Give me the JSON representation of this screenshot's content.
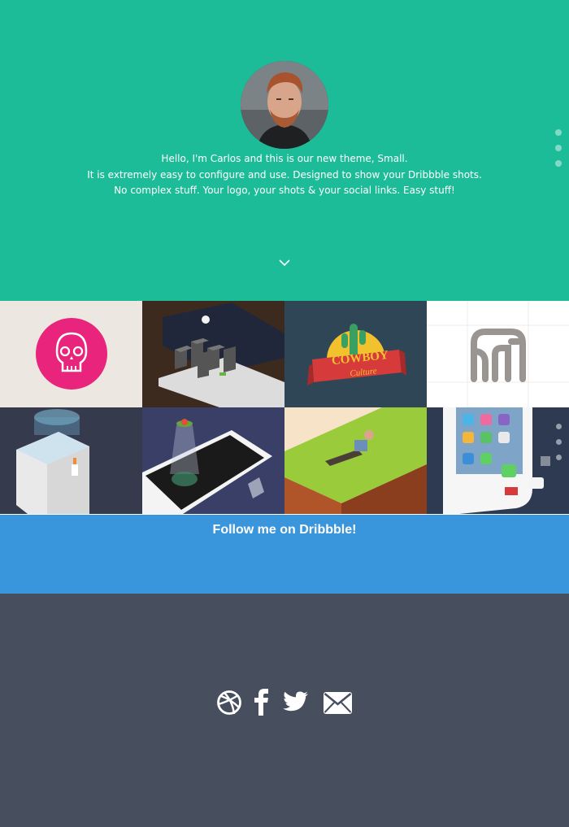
{
  "hero": {
    "background_color": "#1dbc98",
    "intro_lines": [
      "Hello, I'm Carlos and this is our new theme, Small.",
      "It is extremely easy to configure and use. Designed to show your Dribbble shots.",
      "No complex stuff. Your logo, your shots & your social links. Easy stuff!"
    ],
    "scroll_icon": "chevron-down-icon",
    "nav_dots_count": 3
  },
  "shots": [
    {
      "name": "skull-logo",
      "bg": "#ece7e0",
      "accent": "#e8247c"
    },
    {
      "name": "laptop-city",
      "bg": "#3c2a1e",
      "accent": "#dcdcdc"
    },
    {
      "name": "cowboy-culture",
      "bg": "#2f4656",
      "accent": "#d63a3a"
    },
    {
      "name": "elephant-logo",
      "bg": "#ffffff",
      "accent": "#9a9590"
    },
    {
      "name": "water-cooler",
      "bg": "#353a4d",
      "accent": "#eaeaea"
    },
    {
      "name": "phone-ufo",
      "bg": "#3a3f68",
      "accent": "#f5f5f5"
    },
    {
      "name": "man-on-grass",
      "bg": "#f6e3c8",
      "accent": "#9acb3b"
    },
    {
      "name": "iphone-apps",
      "bg": "#2e3a52",
      "accent": "#ffffff"
    }
  ],
  "cowboy_text": {
    "line1": "COWBOY",
    "line2": "Culture"
  },
  "follow": {
    "label": "Follow me on Dribbble!",
    "background_color": "#3a96dc"
  },
  "footer": {
    "background_color": "#474e5e",
    "social_icons": [
      "dribbble-icon",
      "facebook-icon",
      "twitter-icon",
      "mail-icon"
    ]
  }
}
